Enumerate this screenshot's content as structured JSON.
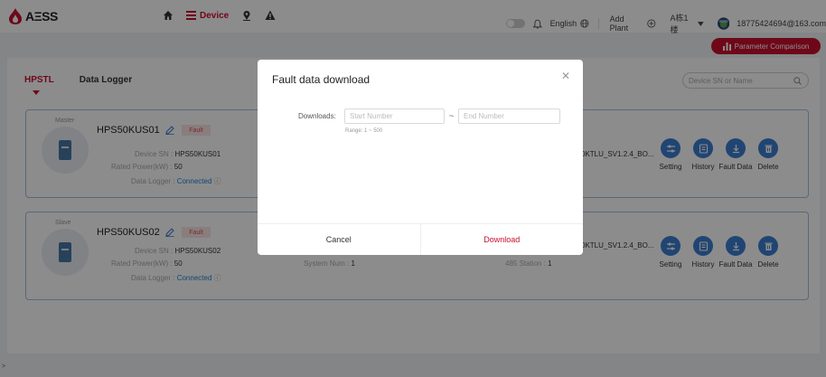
{
  "header": {
    "logo_text": "AΞSS",
    "nav_device_label": "Device",
    "language": "English",
    "add_plant": "Add Plant",
    "building": "A栋1楼",
    "user_email": "18775424694@163.com",
    "param_compare": "Parameter Comparison"
  },
  "tabs": {
    "active": "HPSTL",
    "other": "Data Logger"
  },
  "search": {
    "placeholder": "Device SN or Name"
  },
  "devices": [
    {
      "role": "Master",
      "name": "HPS50KUS01",
      "status": "Fault",
      "sn_label": "Device SN",
      "sn": "HPS50KUS01",
      "power_label": "Rated Power(kW)",
      "power": "50",
      "logger_label": "Data Logger",
      "logger_status": "Connected",
      "version": "0KTLU_SV1.2.4_BO..."
    },
    {
      "role": "Slave",
      "name": "HPS50KUS02",
      "status": "Fault",
      "sn_label": "Device SN",
      "sn": "HPS50KUS02",
      "power_label": "Rated Power(kW)",
      "power": "50",
      "logger_label": "Data Logger",
      "logger_status": "Connected",
      "system_num_label": "System Num",
      "system_num": "1",
      "station_label": "485 Station",
      "station": "1",
      "version": "0KTLU_SV1.2.4_BO..."
    }
  ],
  "actions": [
    "Setting",
    "History",
    "Fault Data",
    "Delete"
  ],
  "modal": {
    "title": "Fault data download",
    "downloads_label": "Downloads:",
    "start_placeholder": "Start Number",
    "end_placeholder": "End Number",
    "tilde": "~",
    "range_hint": "Range: 1 ~ 500",
    "cancel": "Cancel",
    "download": "Download"
  },
  "colors": {
    "brand": "#c8102e",
    "accent": "#3d7ed1"
  }
}
